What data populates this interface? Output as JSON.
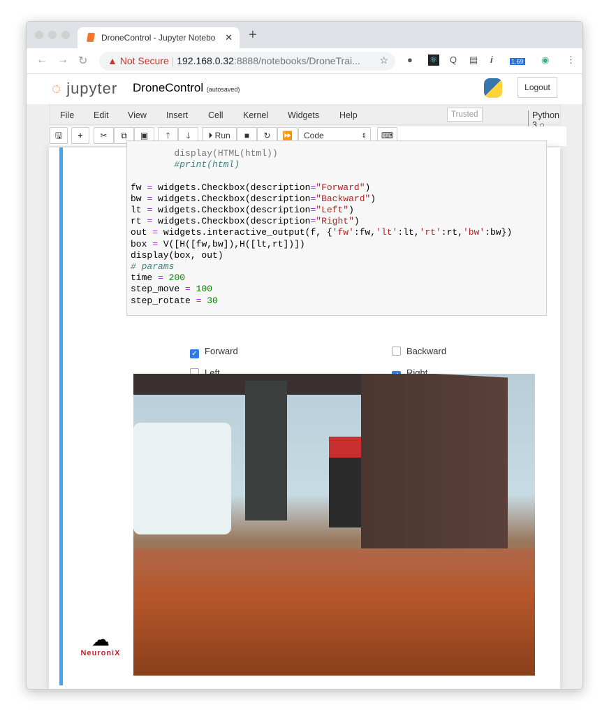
{
  "browser": {
    "tab_title": "DroneControl - Jupyter Notebo",
    "not_secure": "Not Secure",
    "url_host": "192.168.0.32",
    "url_path": ":8888/notebooks/DroneTrai...",
    "badge": "1.69"
  },
  "jupyter": {
    "logo": "jupyter",
    "title": "DroneControl",
    "autosave": "(autosaved)",
    "logout": "Logout",
    "menu": [
      "File",
      "Edit",
      "View",
      "Insert",
      "Cell",
      "Kernel",
      "Widgets",
      "Help"
    ],
    "trusted": "Trusted",
    "kernel": "Python 3",
    "toolbar": {
      "run": "Run",
      "cell_type": "Code"
    }
  },
  "code": {
    "lines_top": [
      "        display(HTML(html))",
      "        #print(html)"
    ]
  },
  "widgets": [
    {
      "label": "Forward",
      "checked": true
    },
    {
      "label": "Backward",
      "checked": false
    },
    {
      "label": "Left",
      "checked": false
    },
    {
      "label": "Right",
      "checked": true
    }
  ],
  "brand": {
    "name": "NeuroniX",
    "color": "#c8202c"
  },
  "colors": {
    "accent": "#42a5f5",
    "checkbox": "#2f7ae5"
  }
}
